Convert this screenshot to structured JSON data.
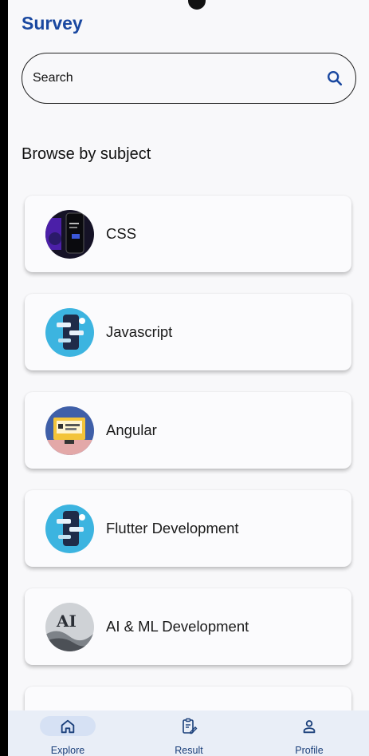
{
  "app": {
    "title": "Survey"
  },
  "search": {
    "placeholder": "Search"
  },
  "section": {
    "title": "Browse by subject"
  },
  "subjects": [
    {
      "label": "CSS",
      "icon": "css-thumbnail"
    },
    {
      "label": "Javascript",
      "icon": "javascript-thumbnail"
    },
    {
      "label": "Angular",
      "icon": "angular-thumbnail"
    },
    {
      "label": "Flutter Development",
      "icon": "flutter-thumbnail"
    },
    {
      "label": "AI & ML Development",
      "icon": "ai-ml-thumbnail"
    },
    {
      "label": "",
      "icon": "partial-thumbnail"
    }
  ],
  "nav": {
    "items": [
      {
        "label": "Explore",
        "icon": "home-icon",
        "active": true
      },
      {
        "label": "Result",
        "icon": "clipboard-edit-icon",
        "active": false
      },
      {
        "label": "Profile",
        "icon": "person-icon",
        "active": false
      }
    ]
  },
  "colors": {
    "accent": "#1a48a0",
    "nav_bg": "#e9eef7",
    "nav_active": "#d6e1f4"
  }
}
